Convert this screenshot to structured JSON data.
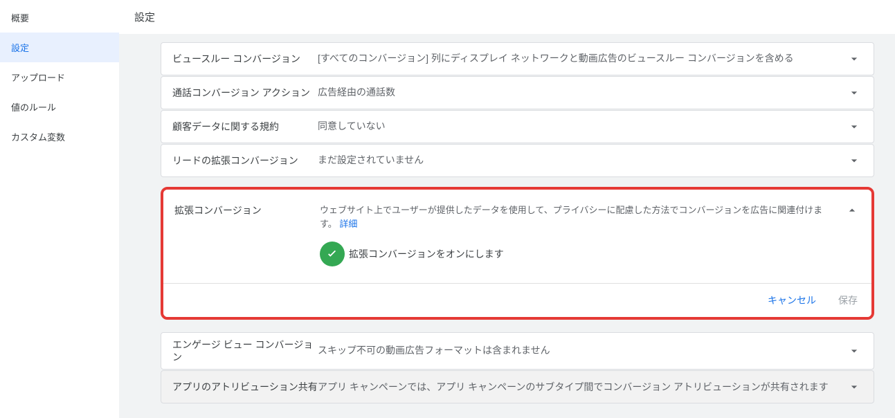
{
  "sidebar": {
    "items": [
      {
        "label": "概要"
      },
      {
        "label": "設定"
      },
      {
        "label": "アップロード"
      },
      {
        "label": "値のルール"
      },
      {
        "label": "カスタム変数"
      }
    ]
  },
  "page": {
    "title": "設定"
  },
  "rows": {
    "view_through": {
      "label": "ビュースルー コンバージョン",
      "value": "[すべてのコンバージョン] 列にディスプレイ ネットワークと動画広告のビュースルー コンバージョンを含める"
    },
    "call": {
      "label": "通話コンバージョン アクション",
      "value": "広告経由の通話数"
    },
    "customer_data": {
      "label": "顧客データに関する規約",
      "value": "同意していない"
    },
    "leads_enhanced": {
      "label": "リードの拡張コンバージョン",
      "value": "まだ設定されていません"
    },
    "enhanced": {
      "label": "拡張コンバージョン",
      "desc": "ウェブサイト上でユーザーが提供したデータを使用して、プライバシーに配慮した方法でコンバージョンを広告に関連付けます。 ",
      "details_link": "詳細",
      "toggle_label": "拡張コンバージョンをオンにします",
      "cancel": "キャンセル",
      "save": "保存"
    },
    "engage_view": {
      "label": "エンゲージ ビュー コンバージョン",
      "value": "スキップ不可の動画広告フォーマットは含まれません"
    },
    "app_attr": {
      "label": "アプリのアトリビューション共有",
      "value": "アプリ キャンペーンでは、アプリ キャンペーンのサブタイプ間でコンバージョン アトリビューションが共有されます"
    }
  }
}
